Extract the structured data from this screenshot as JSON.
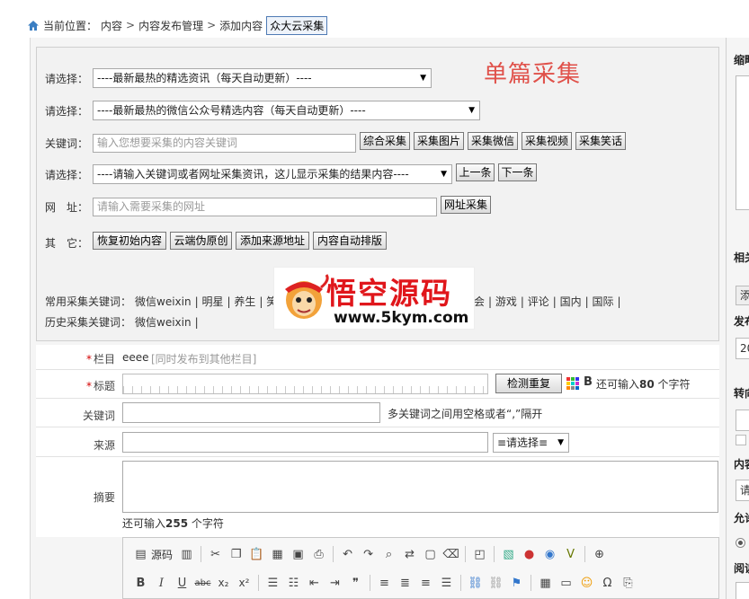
{
  "breadcrumb": {
    "prefix": "当前位置：",
    "items": [
      "内容",
      "内容发布管理",
      "添加内容"
    ],
    "sep": ">",
    "tag_button": "众大云采集"
  },
  "collector": {
    "title": "单篇采集",
    "rows": {
      "select1": {
        "label": "请选择：",
        "value": "----最新最热的精选资讯（每天自动更新）----"
      },
      "select2": {
        "label": "请选择：",
        "value": "----最新最热的微信公众号精选内容（每天自动更新）----"
      },
      "keyword": {
        "label": "关键词：",
        "placeholder": "输入您想要采集的内容关键词",
        "buttons": [
          "综合采集",
          "采集图片",
          "采集微信",
          "采集视频",
          "采集笑话"
        ]
      },
      "select3": {
        "label": "请选择：",
        "value": "----请输入关键词或者网址采集资讯，这儿显示采集的结果内容----",
        "buttons": [
          "上一条",
          "下一条"
        ]
      },
      "url": {
        "label": "网　址：",
        "placeholder": "请输入需要采集的网址",
        "button": "网址采集"
      },
      "other": {
        "label": "其　它：",
        "buttons": [
          "恢复初始内容",
          "云端伪原创",
          "添加来源地址",
          "内容自动排版"
        ]
      }
    },
    "common_keywords": {
      "label": "常用采集关键词：",
      "items_left": [
        "微信weixin",
        "明星",
        "养生",
        "笑"
      ],
      "items_right": [
        "会",
        "游戏",
        "评论",
        "国内",
        "国际"
      ]
    },
    "history_keywords": {
      "label": "历史采集关键词：",
      "items": [
        "微信weixin"
      ]
    }
  },
  "watermark": {
    "text": "悟空源码",
    "url": "www.5kym.com"
  },
  "form": {
    "column": {
      "label": "栏目",
      "value": "eeee",
      "link": "[同时发布到其他栏目]"
    },
    "title": {
      "label": "标题",
      "check_button": "检测重复",
      "bold": "B",
      "hint_prefix": "还可输入",
      "hint_count": "80",
      "hint_suffix": " 个字符"
    },
    "keywords": {
      "label": "关键词",
      "hint": "多关键词之间用空格或者“,”隔开"
    },
    "source": {
      "label": "来源",
      "select": "≡请选择≡"
    },
    "summary": {
      "label": "摘要",
      "hint_prefix": "还可输入",
      "hint_count": "255",
      "hint_suffix": " 个字符"
    }
  },
  "editor": {
    "source_label": "源码"
  },
  "right_panel": {
    "labels": [
      "缩略",
      "相关",
      "发布",
      "转向",
      "内容",
      "允许",
      "阅读"
    ],
    "date_prefix": "20",
    "add_btn": "添",
    "select_prefix": "请"
  },
  "colors": {
    "accent_red": "#e0514a",
    "required": "#d40000",
    "watermark_red": "#e0161b"
  }
}
